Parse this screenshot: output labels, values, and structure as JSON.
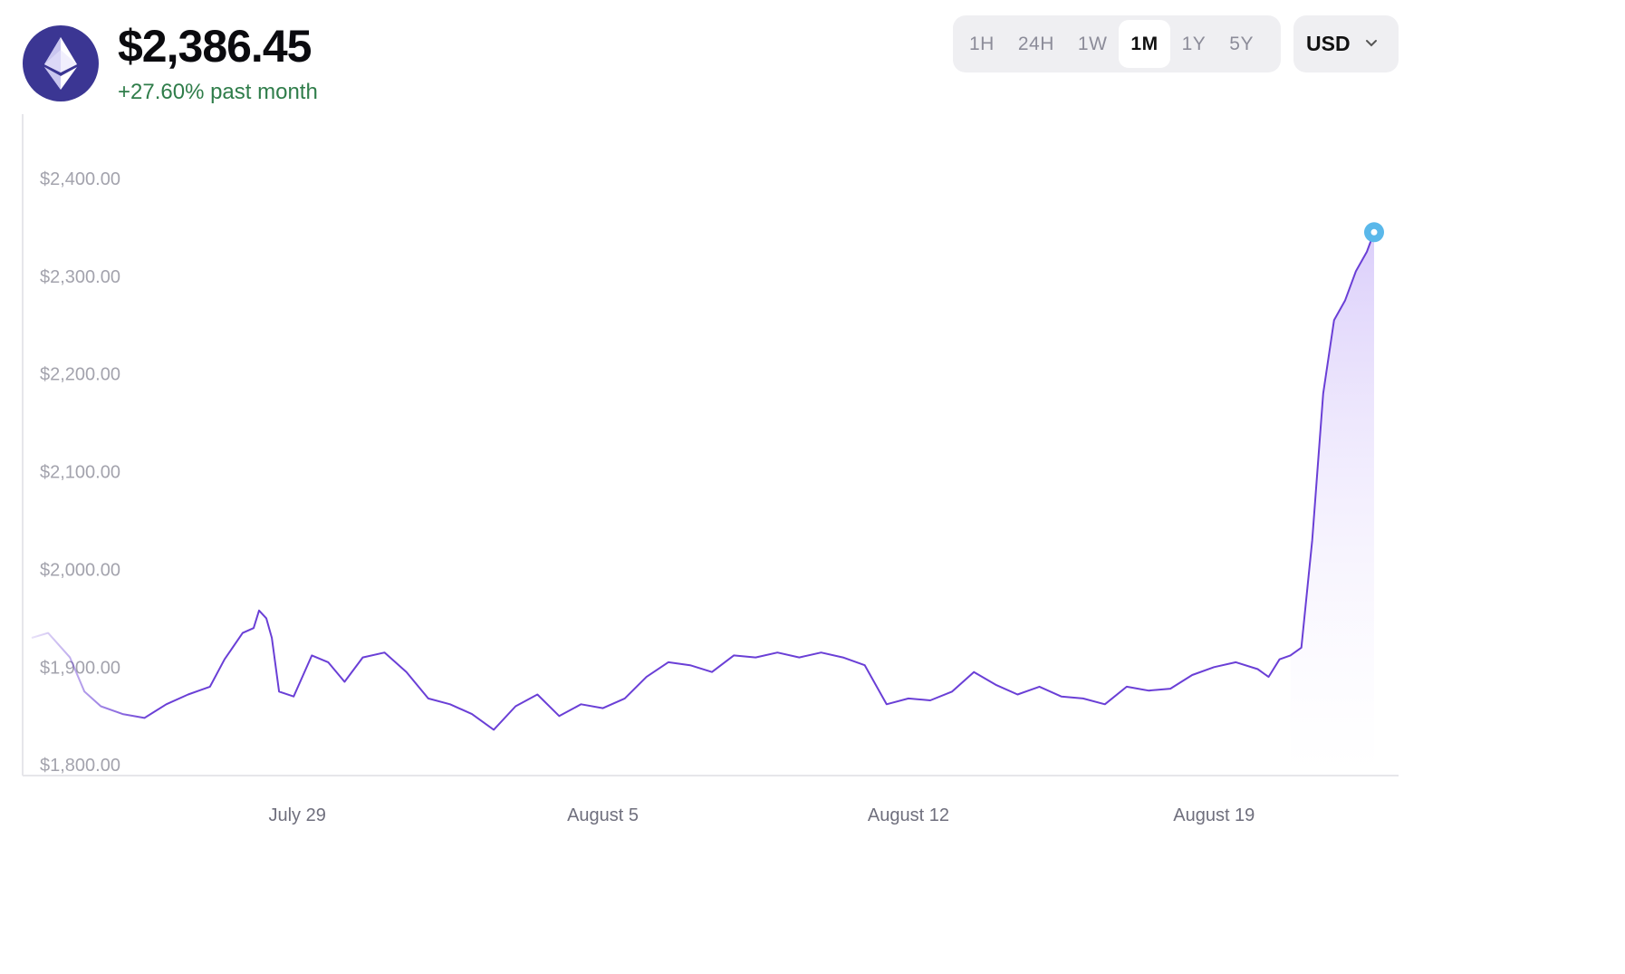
{
  "header": {
    "logo_icon": "ethereum-logo-icon",
    "price": "$2,386.45",
    "change": "+27.60% past month"
  },
  "ranges": [
    {
      "label": "1H",
      "active": false
    },
    {
      "label": "24H",
      "active": false
    },
    {
      "label": "1W",
      "active": false
    },
    {
      "label": "1M",
      "active": true
    },
    {
      "label": "1Y",
      "active": false
    },
    {
      "label": "5Y",
      "active": false
    }
  ],
  "currency": {
    "label": "USD",
    "icon": "chevron-down-icon"
  },
  "colors": {
    "line": "#6a3fd6",
    "fill": "#e7defc",
    "marker": "#5ab8ea",
    "change_positive": "#2f7d4a"
  },
  "chart_data": {
    "type": "area",
    "title": "",
    "xlabel": "",
    "ylabel": "",
    "ylim": [
      1790,
      2425
    ],
    "xlim": [
      "2024-07-22T22:00",
      "2024-08-22T16:00"
    ],
    "y_ticks": [
      {
        "value": 2400,
        "label": "$2,400.00"
      },
      {
        "value": 2300,
        "label": "$2,300.00"
      },
      {
        "value": 2200,
        "label": "$2,200.00"
      },
      {
        "value": 2100,
        "label": "$2,100.00"
      },
      {
        "value": 2000,
        "label": "$2,000.00"
      },
      {
        "value": 1900,
        "label": "$1,900.00"
      },
      {
        "value": 1800,
        "label": "$1,800.00"
      }
    ],
    "x_ticks": [
      {
        "value": "2024-07-29",
        "label": "July 29"
      },
      {
        "value": "2024-08-05",
        "label": "August 5"
      },
      {
        "value": "2024-08-12",
        "label": "August 12"
      },
      {
        "value": "2024-08-19",
        "label": "August 19"
      }
    ],
    "reference_price": 2345,
    "grid": false,
    "legend": "none",
    "series": [
      {
        "x": [
          "2024-07-22T22:00",
          "2024-07-23T07:00",
          "2024-07-23T19:00",
          "2024-07-24T03:00",
          "2024-07-24T12:00",
          "2024-07-25T00:00",
          "2024-07-25T12:00",
          "2024-07-26T00:00",
          "2024-07-26T12:00",
          "2024-07-27T00:00",
          "2024-07-27T08:00",
          "2024-07-27T18:00",
          "2024-07-28T00:00",
          "2024-07-28T03:00",
          "2024-07-28T07:00",
          "2024-07-28T10:00",
          "2024-07-28T14:00",
          "2024-07-28T22:00",
          "2024-07-29T08:00",
          "2024-07-29T17:00",
          "2024-07-30T02:00",
          "2024-07-30T12:00",
          "2024-07-31T00:00",
          "2024-07-31T12:00",
          "2024-08-01T00:00",
          "2024-08-01T12:00",
          "2024-08-02T00:00",
          "2024-08-02T12:00",
          "2024-08-03T00:00",
          "2024-08-03T12:00",
          "2024-08-04T00:00",
          "2024-08-04T12:00",
          "2024-08-05T00:00",
          "2024-08-05T12:00",
          "2024-08-06T00:00",
          "2024-08-06T12:00",
          "2024-08-07T00:00",
          "2024-08-07T12:00",
          "2024-08-08T00:00",
          "2024-08-08T12:00",
          "2024-08-09T00:00",
          "2024-08-09T12:00",
          "2024-08-10T00:00",
          "2024-08-10T12:00",
          "2024-08-11T00:00",
          "2024-08-11T12:00",
          "2024-08-12T00:00",
          "2024-08-12T12:00",
          "2024-08-13T00:00",
          "2024-08-13T12:00",
          "2024-08-14T00:00",
          "2024-08-14T12:00",
          "2024-08-15T00:00",
          "2024-08-15T12:00",
          "2024-08-16T00:00",
          "2024-08-16T12:00",
          "2024-08-17T00:00",
          "2024-08-17T12:00",
          "2024-08-18T00:00",
          "2024-08-18T12:00",
          "2024-08-19T00:00",
          "2024-08-19T12:00",
          "2024-08-20T00:00",
          "2024-08-20T06:00",
          "2024-08-20T12:00",
          "2024-08-20T18:00",
          "2024-08-21T00:00",
          "2024-08-21T06:00",
          "2024-08-21T12:00",
          "2024-08-21T18:00",
          "2024-08-22T00:00",
          "2024-08-22T06:00",
          "2024-08-22T12:00",
          "2024-08-22T16:00"
        ],
        "values": [
          1930,
          1935,
          1910,
          1875,
          1860,
          1852,
          1848,
          1862,
          1872,
          1880,
          1908,
          1935,
          1940,
          1958,
          1950,
          1930,
          1875,
          1870,
          1912,
          1905,
          1885,
          1910,
          1915,
          1895,
          1868,
          1862,
          1852,
          1836,
          1860,
          1872,
          1850,
          1862,
          1858,
          1868,
          1890,
          1905,
          1902,
          1895,
          1912,
          1910,
          1915,
          1910,
          1915,
          1910,
          1902,
          1862,
          1868,
          1866,
          1875,
          1895,
          1882,
          1872,
          1880,
          1870,
          1868,
          1862,
          1880,
          1876,
          1878,
          1892,
          1900,
          1905,
          1898,
          1890,
          1908,
          1912,
          1920,
          2030,
          2180,
          2255,
          2275,
          2305,
          2325,
          2345
        ]
      }
    ]
  }
}
